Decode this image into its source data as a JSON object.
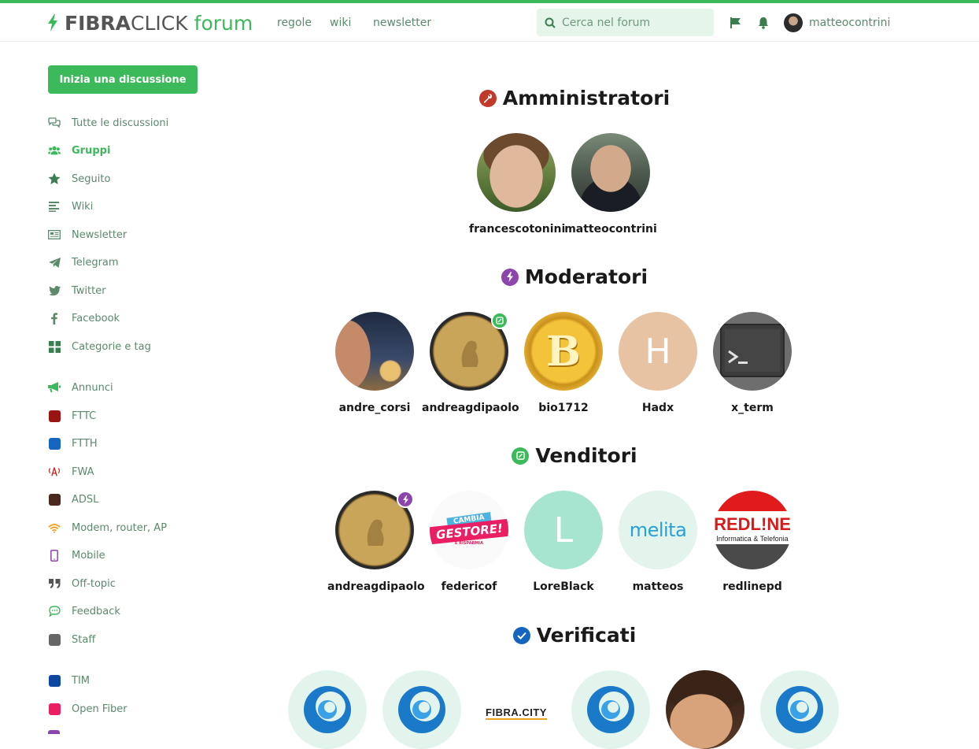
{
  "header": {
    "logo_bold": "FIBRA",
    "logo_light": "CLICK",
    "logo_forum": "forum",
    "nav": [
      "regole",
      "wiki",
      "newsletter"
    ],
    "search_placeholder": "Cerca nel forum",
    "username": "matteocontrini"
  },
  "sidebar": {
    "new_discussion": "Inizia una discussione",
    "items": [
      {
        "label": "Tutte le discussioni",
        "icon": "comments-icon"
      },
      {
        "label": "Gruppi",
        "icon": "users-icon"
      },
      {
        "label": "Seguito",
        "icon": "star-icon"
      },
      {
        "label": "Wiki",
        "icon": "lines-icon"
      },
      {
        "label": "Newsletter",
        "icon": "newspaper-icon"
      },
      {
        "label": "Telegram",
        "icon": "telegram-icon"
      },
      {
        "label": "Twitter",
        "icon": "twitter-icon"
      },
      {
        "label": "Facebook",
        "icon": "facebook-icon"
      },
      {
        "label": "Categorie e tag",
        "icon": "grid-icon"
      }
    ],
    "tags": [
      {
        "label": "Annunci",
        "icon": "megaphone-icon",
        "color": "#3cb95a"
      },
      {
        "label": "FTTC",
        "color": "#9b1414"
      },
      {
        "label": "FTTH",
        "color": "#1565c0"
      },
      {
        "label": "FWA",
        "icon": "antenna-icon",
        "color": "#c62828"
      },
      {
        "label": "ADSL",
        "color": "#4a2a1e"
      },
      {
        "label": "Modem, router, AP",
        "icon": "wifi-icon",
        "color": "#f39c12"
      },
      {
        "label": "Mobile",
        "icon": "mobile-icon",
        "color": "#8e44ad"
      },
      {
        "label": "Off-topic",
        "icon": "quote-icon",
        "color": "#555555"
      },
      {
        "label": "Feedback",
        "icon": "chat-icon",
        "color": "#3cb95a"
      },
      {
        "label": "Staff",
        "color": "#666666"
      },
      {
        "label": "TIM",
        "color": "#0d47a1"
      },
      {
        "label": "Open Fiber",
        "color": "#e91e63"
      }
    ]
  },
  "groups": {
    "amministratori": {
      "title": "Amministratori",
      "icon": "wrench-icon",
      "color": "#c0392b",
      "members": [
        "francescotonini",
        "matteocontrini"
      ]
    },
    "moderatori": {
      "title": "Moderatori",
      "icon": "bolt-icon",
      "color": "#8e44ad",
      "members": [
        "andre_corsi",
        "andreagdipaolo",
        "bio1712",
        "Hadx",
        "x_term"
      ]
    },
    "venditori": {
      "title": "Venditori",
      "icon": "phone-icon",
      "color": "#3cb95a",
      "members": [
        "andreagdipaolo",
        "federicof",
        "LoreBlack",
        "matteos",
        "redlinepd"
      ]
    },
    "verificati": {
      "title": "Verificati",
      "icon": "check-icon",
      "color": "#1565c0"
    }
  },
  "avatar_text": {
    "hadx_initial": "H",
    "loreblack_initial": "L",
    "melita": "melita",
    "redline_top": "REDL!NE",
    "redline_sub": "Informatica & Telefonia",
    "cambia_top": "CAMBIA",
    "cambia_mid": "GESTORE!",
    "cambia_bot": "E RISPARMIA",
    "fibracity": "FIBRA.CITY",
    "bitcoin": "B"
  }
}
